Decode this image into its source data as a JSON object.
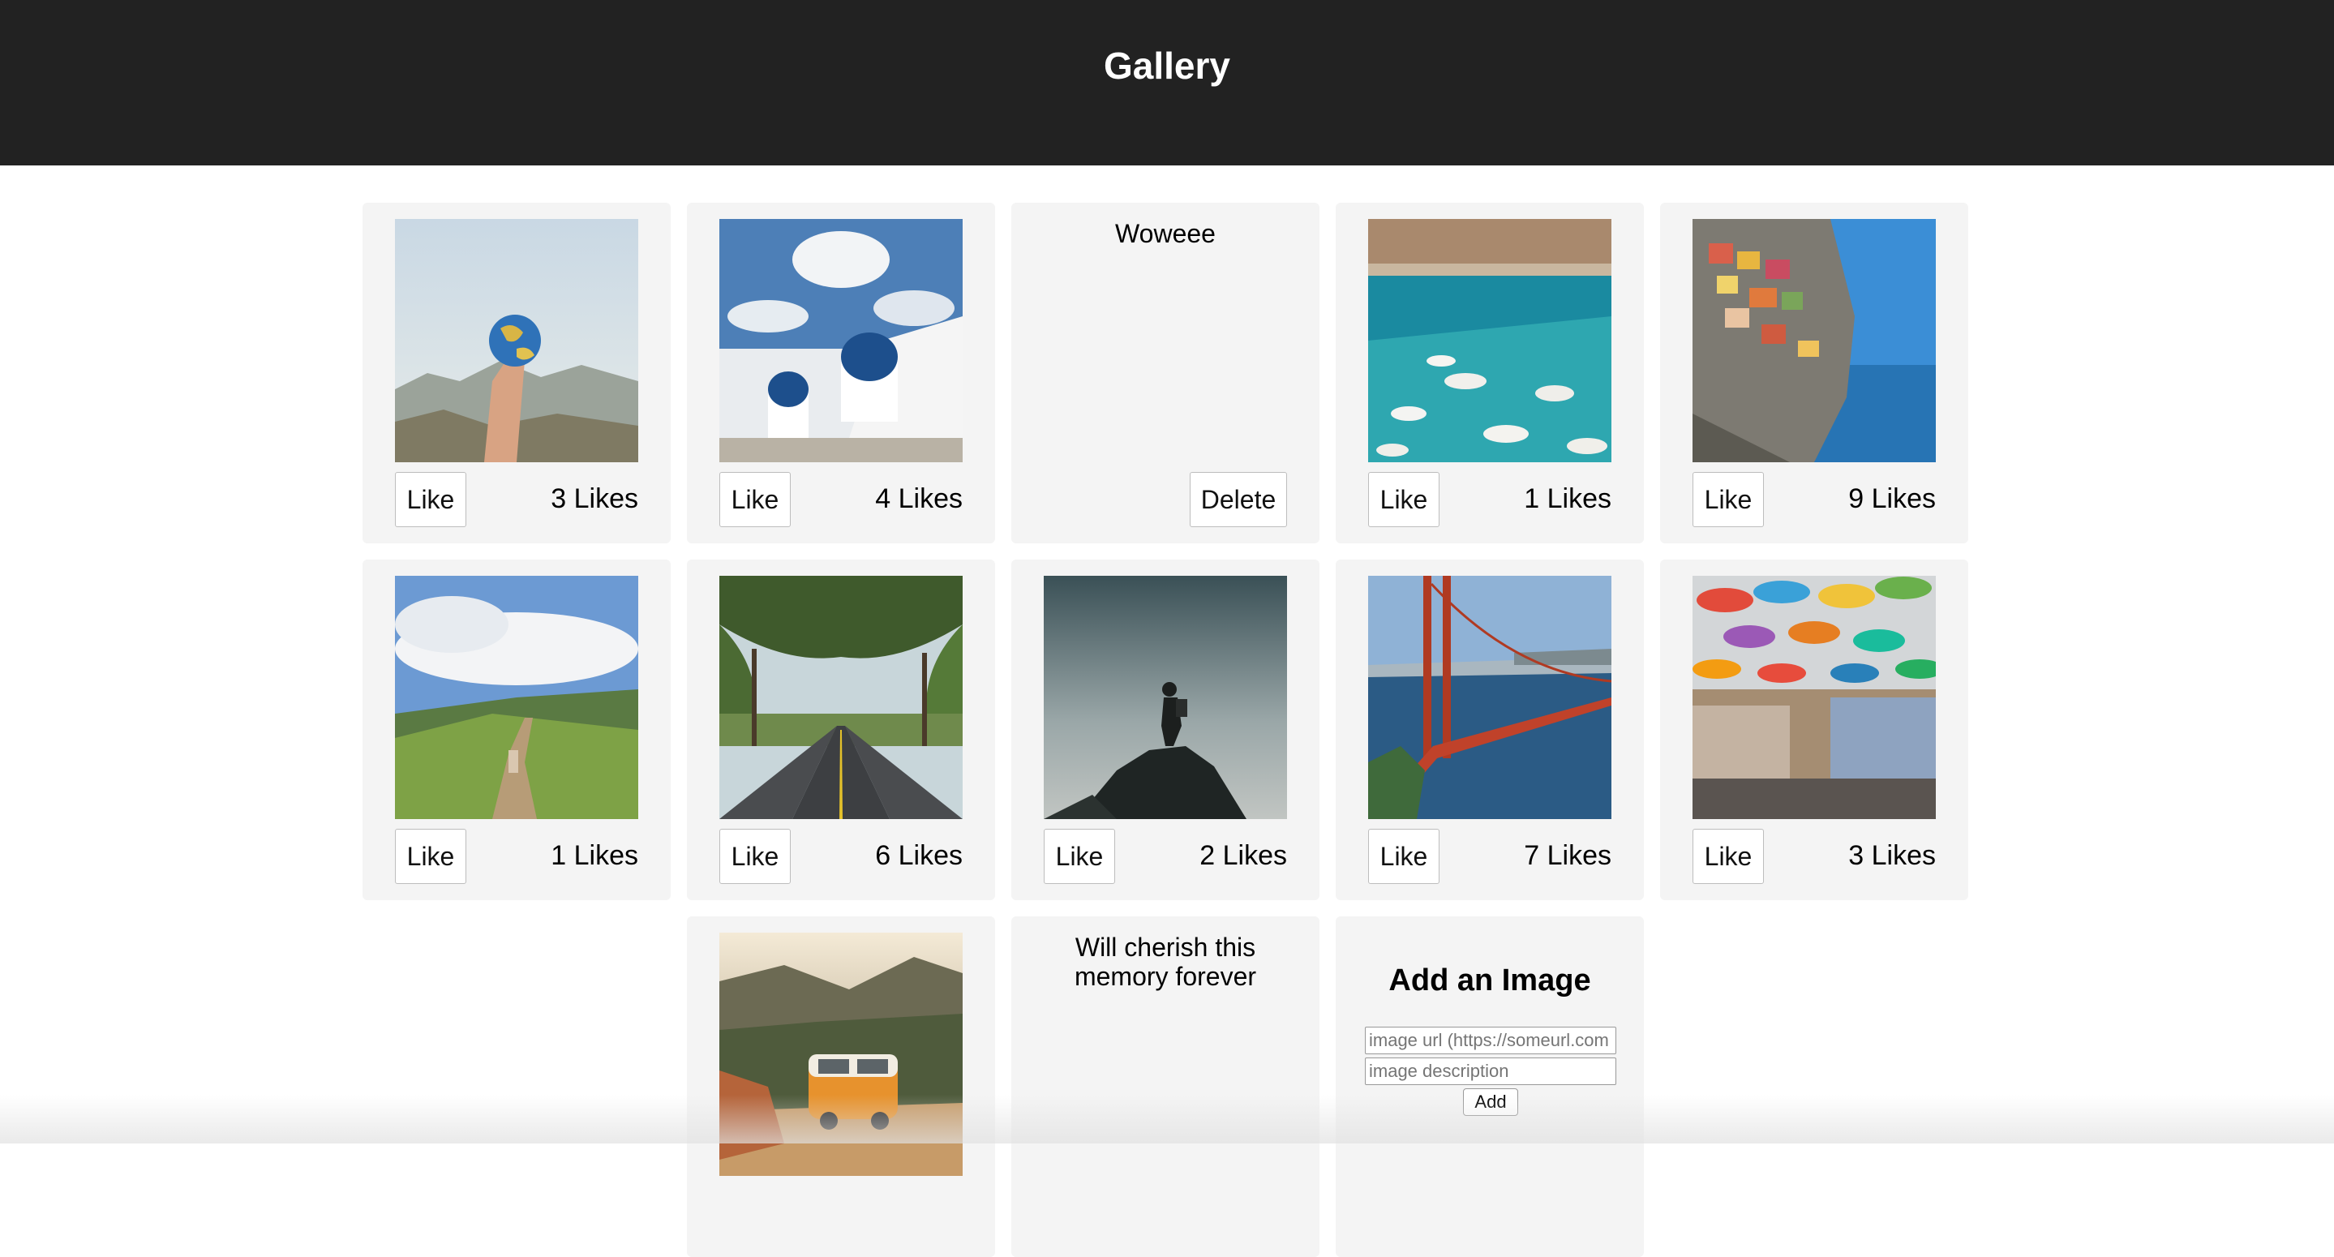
{
  "header": {
    "title": "Gallery"
  },
  "cards": [
    {
      "kind": "photo",
      "image": "hand-holding-globe",
      "like_label": "Like",
      "likes": "3 Likes"
    },
    {
      "kind": "photo",
      "image": "santorini-blue-domes",
      "like_label": "Like",
      "likes": "4 Likes"
    },
    {
      "kind": "text",
      "text": "Woweee",
      "delete_label": "Delete"
    },
    {
      "kind": "photo",
      "image": "boats-turquoise-harbor",
      "like_label": "Like",
      "likes": "1 Likes"
    },
    {
      "kind": "photo",
      "image": "cliffside-village",
      "like_label": "Like",
      "likes": "9 Likes"
    },
    {
      "kind": "photo",
      "image": "hiking-trail-hills",
      "like_label": "Like",
      "likes": "1 Likes"
    },
    {
      "kind": "photo",
      "image": "tree-lined-road",
      "like_label": "Like",
      "likes": "6 Likes"
    },
    {
      "kind": "photo",
      "image": "hiker-on-rock",
      "like_label": "Like",
      "likes": "2 Likes"
    },
    {
      "kind": "photo",
      "image": "golden-gate-bridge",
      "like_label": "Like",
      "likes": "7 Likes"
    },
    {
      "kind": "photo",
      "image": "umbrella-street",
      "like_label": "Like",
      "likes": "3 Likes"
    },
    {
      "kind": "photo",
      "image": "orange-van-mountains"
    },
    {
      "kind": "text",
      "text": "Will cherish this memory forever"
    }
  ],
  "add_form": {
    "title": "Add an Image",
    "url_placeholder": "image url (https://someurl.com",
    "description_placeholder": "image description",
    "add_label": "Add"
  },
  "colors": {
    "header_bg": "#222222",
    "card_bg": "#f4f4f4",
    "page_bg": "#ffffff"
  }
}
